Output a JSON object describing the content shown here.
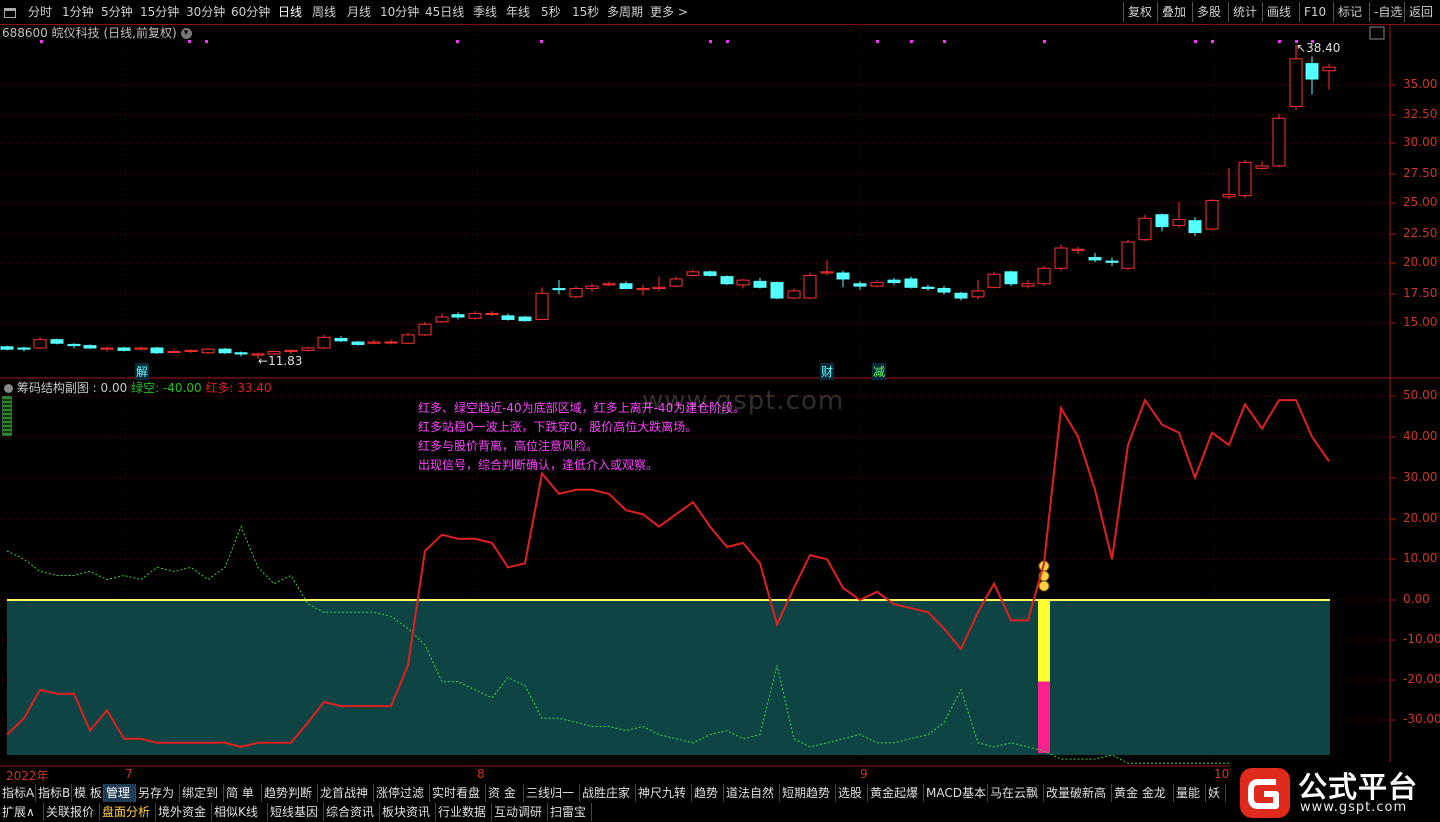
{
  "toolbar": {
    "periods": [
      "分时",
      "1分钟",
      "5分钟",
      "15分钟",
      "30分钟",
      "60分钟",
      "日线",
      "周线",
      "月线",
      "10分钟",
      "45日线",
      "季线",
      "年线",
      "5秒",
      "15秒",
      "多周期",
      "更多 >"
    ],
    "right": [
      "复权",
      "叠加",
      "多股",
      "统计",
      "画线",
      "F10",
      "标记",
      "-自选",
      "返回"
    ]
  },
  "stock": {
    "code": "688600",
    "name": "皖仪科技",
    "period": "(日线,前复权)"
  },
  "price_axis": [
    "35.00",
    "32.50",
    "30.00",
    "27.50",
    "25.00",
    "22.50",
    "20.00",
    "17.50",
    "15.00"
  ],
  "price_high_label": "38.40",
  "price_low_label": "11.83",
  "event_tags": [
    "解",
    "财",
    "减"
  ],
  "indicator": {
    "name": "筹码结构副图",
    "value0": ": 0.00",
    "green_label": "绿空: -40.00",
    "red_label": "红多: 33.40"
  },
  "ind_axis": [
    "50.00",
    "40.00",
    "30.00",
    "20.00",
    "10.00",
    "0.00",
    "-10.00",
    "-20.00",
    "-30.00"
  ],
  "description": [
    "红多、绿空趋近-40为底部区域，红多上离开-40为建仓阶段。",
    "红多站稳0一波上涨，下跌穿0，股价高位大跌离场。",
    "红多与股价背离，高位注意风险。",
    "出现信号，综合判断确认，逢低介入或观察。"
  ],
  "watermark": "www.gspt.com",
  "date_labels": [
    "2022年",
    "7",
    "8",
    "9",
    "10"
  ],
  "bottom_row1": [
    "指标A",
    "指标B",
    "模 板",
    "管理",
    "另存为",
    "绑定到",
    "简 单",
    "趋势判断",
    "龙首战神",
    "涨停过滤",
    "实时看盘",
    "资 金",
    "三线归一",
    "战胜庄家",
    "神尺九转",
    "趋势",
    "道法自然",
    "短期趋势",
    "选股",
    "黄金起爆",
    "MACD基本",
    "马在云飘",
    "改量破新高",
    "黄金 金龙",
    "量能",
    "妖"
  ],
  "bottom_row2": [
    "扩展∧",
    "关联报价",
    "盘面分析",
    "境外资金",
    "相似K线",
    "短线基因",
    "综合资讯",
    "板块资讯",
    "行业数据",
    "互动调研",
    "扫雷宝"
  ],
  "logo": {
    "text": "公式平台",
    "url": "www.gspt.com"
  },
  "colors": {
    "red": "#e02020",
    "green": "#20c020",
    "cyan": "#54ffff",
    "yellow": "#ffff30",
    "magenta": "#ff2090",
    "teal": "#0f4444",
    "accent": "#c8372a"
  }
}
